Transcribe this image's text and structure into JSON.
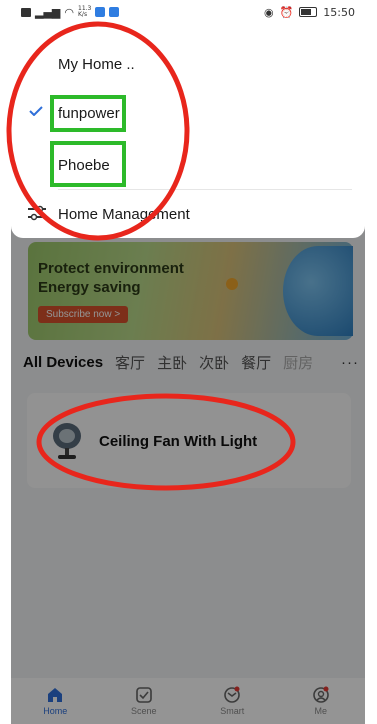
{
  "status_bar": {
    "network_speed": "11.3\nK/s",
    "time": "15:50"
  },
  "home_menu": {
    "header": "My Home ..",
    "homes": [
      {
        "label": "funpower",
        "selected": true
      },
      {
        "label": "Phoebe",
        "selected": false
      }
    ],
    "manage_label": "Home Management"
  },
  "banner": {
    "line1": "Protect environment",
    "line2": "Energy saving",
    "button_label": "Subscribe now >"
  },
  "device_tabs": [
    "All Devices",
    "客厅",
    "主卧",
    "次卧",
    "餐厅",
    "厨房"
  ],
  "more_tabs_label": "···",
  "devices": [
    {
      "name": "Ceiling Fan With Light"
    }
  ],
  "bottom_nav": [
    {
      "label": "Home",
      "active": true
    },
    {
      "label": "Scene",
      "active": false
    },
    {
      "label": "Smart",
      "active": false
    },
    {
      "label": "Me",
      "active": false
    }
  ],
  "colors": {
    "accent": "#2f6fd9",
    "annotation_red": "#e8261c",
    "annotation_green": "#2dba2a"
  }
}
